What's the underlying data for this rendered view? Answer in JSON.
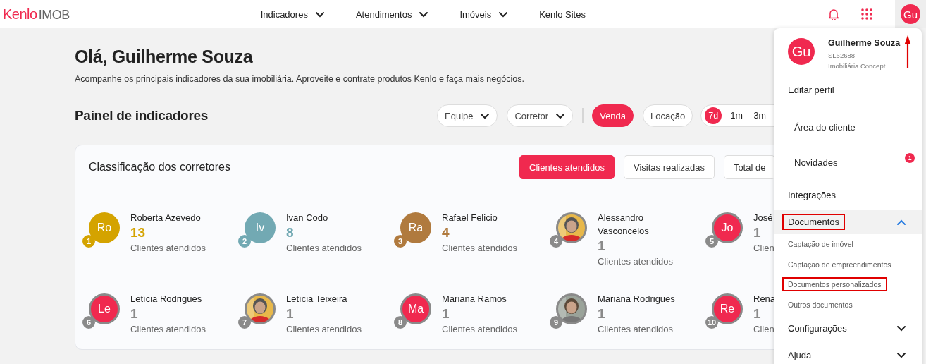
{
  "nav": {
    "logo": {
      "brand": "Kenlo",
      "product": "IMOB"
    },
    "items": [
      {
        "label": "Indicadores",
        "has_menu": true
      },
      {
        "label": "Atendimentos",
        "has_menu": true
      },
      {
        "label": "Imóveis",
        "has_menu": true
      },
      {
        "label": "Kenlo Sites",
        "has_menu": false
      }
    ],
    "user_initials": "Gu"
  },
  "greeting": {
    "title": "Olá, Guilherme Souza",
    "subtitle": "Acompanhe os principais indicadores da sua imobiliária. Aproveite e contrate produtos Kenlo e faça mais negócios."
  },
  "panel": {
    "title": "Painel de indicadores",
    "filters": [
      {
        "label": "Equipe"
      },
      {
        "label": "Corretor"
      }
    ],
    "business_types": [
      {
        "label": "Venda",
        "selected": true
      },
      {
        "label": "Locação",
        "selected": false
      }
    ],
    "periods": [
      {
        "label": "7d",
        "selected": true
      },
      {
        "label": "1m",
        "selected": false
      },
      {
        "label": "3m",
        "selected": false
      }
    ]
  },
  "ranking": {
    "title": "Classificação dos corretores",
    "metrics": [
      {
        "label": "Clientes atendidos",
        "selected": true
      },
      {
        "label": "Visitas realizadas",
        "selected": false
      },
      {
        "label": "Total de",
        "selected": false
      }
    ],
    "brokers": [
      {
        "rank": "1",
        "kind": "initials",
        "initials": "Ro",
        "color": "#d4a300",
        "podium": true,
        "name": "Roberta Azevedo",
        "count": "13",
        "label": "Clientes atendidos"
      },
      {
        "rank": "2",
        "kind": "initials",
        "initials": "Iv",
        "color": "#72a9b3",
        "podium": true,
        "name": "Ivan Codo",
        "count": "8",
        "label": "Clientes atendidos"
      },
      {
        "rank": "3",
        "kind": "initials",
        "initials": "Ra",
        "color": "#b07a3e",
        "podium": true,
        "name": "Rafael Felicio",
        "count": "4",
        "label": "Clientes atendidos"
      },
      {
        "rank": "4",
        "podium": false,
        "name": "Alessandro Vasconcelos",
        "count": "1",
        "label": "Clientes atendidos"
      },
      {
        "rank": "5",
        "kind": "initials",
        "initials": "Jo",
        "color": "#f0294f",
        "podium": false,
        "name": "José",
        "count": "1",
        "label": "Clien"
      },
      {
        "rank": "6",
        "kind": "initials",
        "initials": "Le",
        "color": "#f0294f",
        "podium": false,
        "name": "Letícia Rodrigues",
        "count": "1",
        "label": "Clientes atendidos"
      },
      {
        "rank": "7",
        "podium": false,
        "name": "Letícia Teixeira",
        "count": "1",
        "label": "Clientes atendidos"
      },
      {
        "rank": "8",
        "kind": "initials",
        "initials": "Ma",
        "color": "#f0294f",
        "podium": false,
        "name": "Mariana Ramos",
        "count": "1",
        "label": "Clientes atendidos"
      },
      {
        "rank": "9",
        "podium": false,
        "name": "Mariana Rodrigues",
        "count": "1",
        "label": "Clientes atendidos"
      },
      {
        "rank": "10",
        "kind": "initials",
        "initials": "Re",
        "color": "#f0294f",
        "podium": false,
        "name": "Rena",
        "count": "1",
        "label": "Clien"
      }
    ]
  },
  "user_menu": {
    "initials": "Gu",
    "name": "Guilherme Souza",
    "code": "SL62688",
    "company": "Imobiliária Concept",
    "items": [
      {
        "kind": "link",
        "label": "Editar perfil",
        "highlighted": false
      },
      {
        "kind": "divider"
      },
      {
        "kind": "nested",
        "label": "Área do cliente",
        "highlighted": false
      },
      {
        "kind": "nested",
        "label": "Novidades",
        "badge": "1",
        "highlighted": false
      },
      {
        "kind": "link",
        "label": "Integrações",
        "highlighted": false
      },
      {
        "kind": "section",
        "label": "Documentos",
        "expanded": true,
        "highlighted": true,
        "children": [
          {
            "label": "Captação de imóvel",
            "highlighted": false
          },
          {
            "label": "Captação de empreendimentos",
            "highlighted": false
          },
          {
            "label": "Documentos personalizados",
            "highlighted": true
          },
          {
            "label": "Outros documentos",
            "highlighted": false
          }
        ]
      },
      {
        "kind": "section",
        "label": "Configurações",
        "expanded": false,
        "highlighted": false
      },
      {
        "kind": "section",
        "label": "Ajuda",
        "expanded": false,
        "highlighted": false
      }
    ]
  }
}
